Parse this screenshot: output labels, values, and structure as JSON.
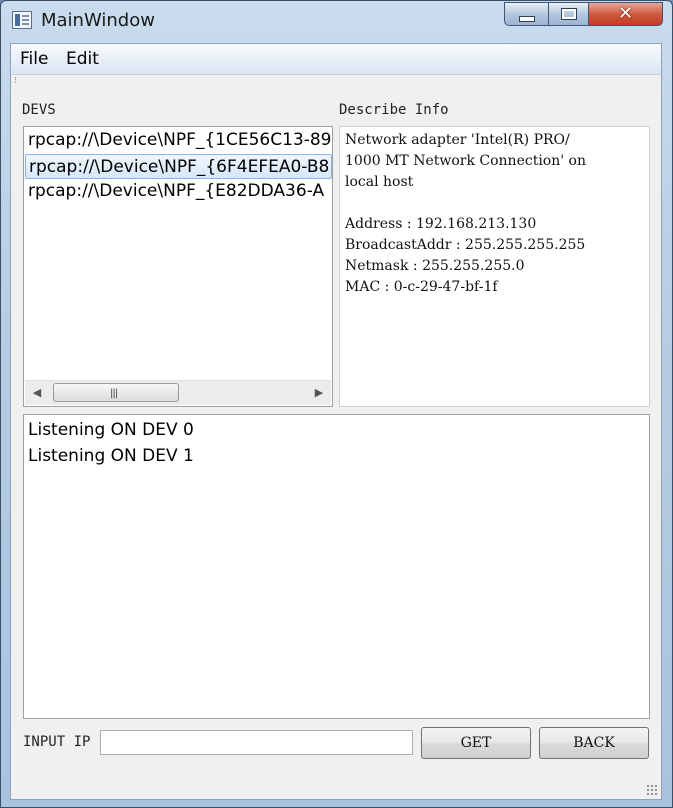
{
  "window": {
    "title": "MainWindow"
  },
  "menu": {
    "items": [
      "File",
      "Edit"
    ]
  },
  "devs": {
    "label": "DEVS",
    "items": [
      "rpcap://\\Device\\NPF_{1CE56C13-89",
      "rpcap://\\Device\\NPF_{6F4EFEA0-B8",
      "rpcap://\\Device\\NPF_{E82DDA36-A"
    ],
    "selected_index": 1
  },
  "describe": {
    "label": "Describe Info",
    "lines": [
      "Network adapter 'Intel(R) PRO/",
      "1000 MT Network Connection' on",
      "local host",
      "",
      "Address : 192.168.213.130",
      "BroadcastAddr : 255.255.255.255",
      "Netmask : 255.255.255.0",
      "MAC : 0-c-29-47-bf-1f"
    ]
  },
  "log": {
    "lines": [
      "Listening ON DEV 0",
      "Listening ON DEV 1"
    ]
  },
  "input": {
    "label": "INPUT IP",
    "value": "",
    "placeholder": ""
  },
  "buttons": {
    "get": "GET",
    "back": "BACK"
  },
  "icons": {
    "app": "app-window-icon",
    "minimize": "minimize-icon",
    "maximize": "maximize-icon",
    "close": "close-icon",
    "scroll_left": "chevron-left-icon",
    "scroll_right": "chevron-right-icon",
    "size_grip": "resize-grip-icon"
  },
  "colors": {
    "selection": "#d6e7fa",
    "close_button": "#c23b20",
    "frame": "#b7cde4"
  }
}
